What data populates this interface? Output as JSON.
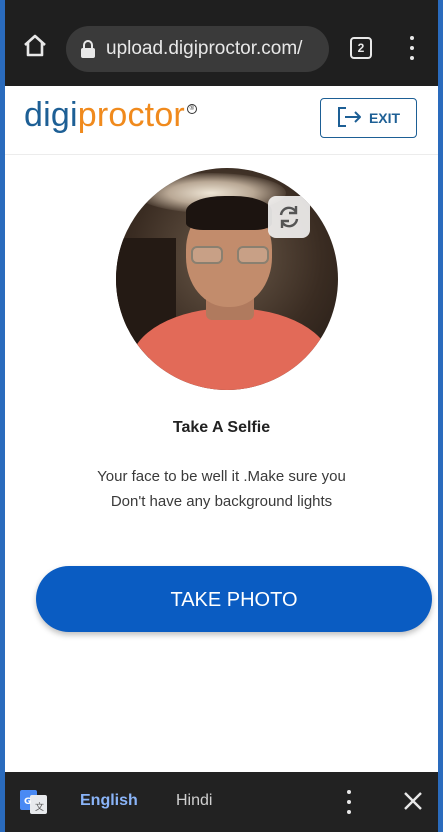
{
  "browser": {
    "url": "upload.digiproctor.com/",
    "tab_count": "2",
    "icons": {
      "home": "home-icon",
      "lock": "lock-icon",
      "menu": "more-vert-icon"
    }
  },
  "app": {
    "logo": {
      "part1": "digi",
      "part2": "proctor",
      "mark": "®"
    },
    "exit_label": "EXIT",
    "colors": {
      "brand_blue": "#1d5f95",
      "brand_orange": "#f08a1d",
      "button_blue": "#0a5cc2"
    }
  },
  "selfie": {
    "title": "Take A Selfie",
    "instruction_line1": "Your face to be well it .Make sure you",
    "instruction_line2": "Don't have any background lights",
    "button_label": "TAKE PHOTO"
  },
  "translate_bar": {
    "lang_source": "English",
    "lang_target": "Hindi"
  }
}
